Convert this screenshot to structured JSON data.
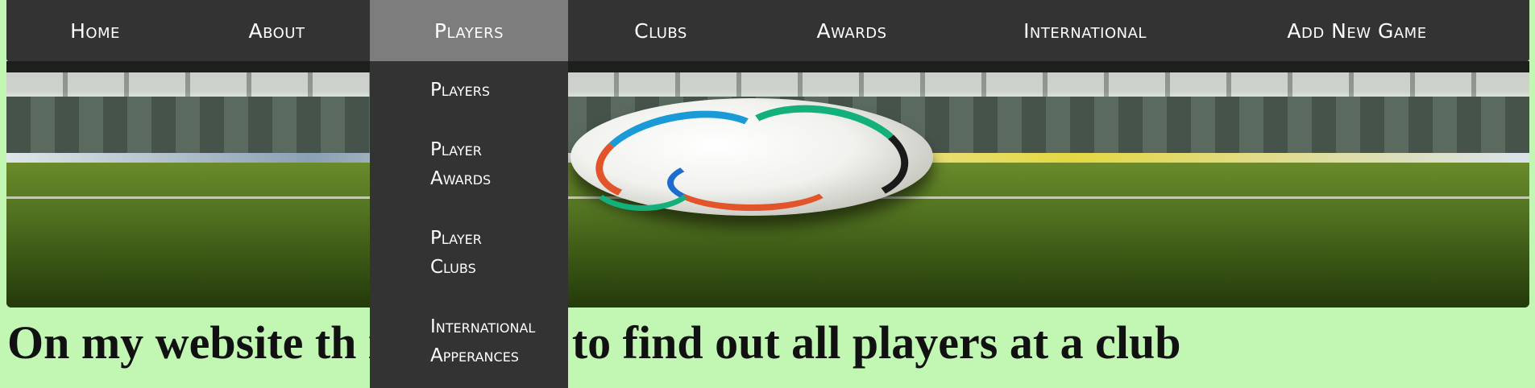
{
  "nav": {
    "items": [
      {
        "label": "Home",
        "active": false
      },
      {
        "label": "About",
        "active": false
      },
      {
        "label": "Players",
        "active": true
      },
      {
        "label": "Clubs",
        "active": false
      },
      {
        "label": "Awards",
        "active": false
      },
      {
        "label": "International",
        "active": false
      },
      {
        "label": "Add New Game",
        "active": false
      }
    ],
    "colors": {
      "bar": "#333333",
      "active": "#7d7d7d",
      "text": "#ffffff"
    }
  },
  "dropdown": {
    "items": [
      {
        "line1": "Players",
        "line2": ""
      },
      {
        "line1": "Player",
        "line2": "Awards"
      },
      {
        "line1": "Player",
        "line2": "Clubs"
      },
      {
        "line1": "International",
        "line2": "Apperances"
      }
    ]
  },
  "hero": {
    "image": "soccer-ball-on-stadium-pitch"
  },
  "main": {
    "headline": "On my website th ill be able to find out all players at a club"
  },
  "page": {
    "background": "#c1f7b2"
  }
}
